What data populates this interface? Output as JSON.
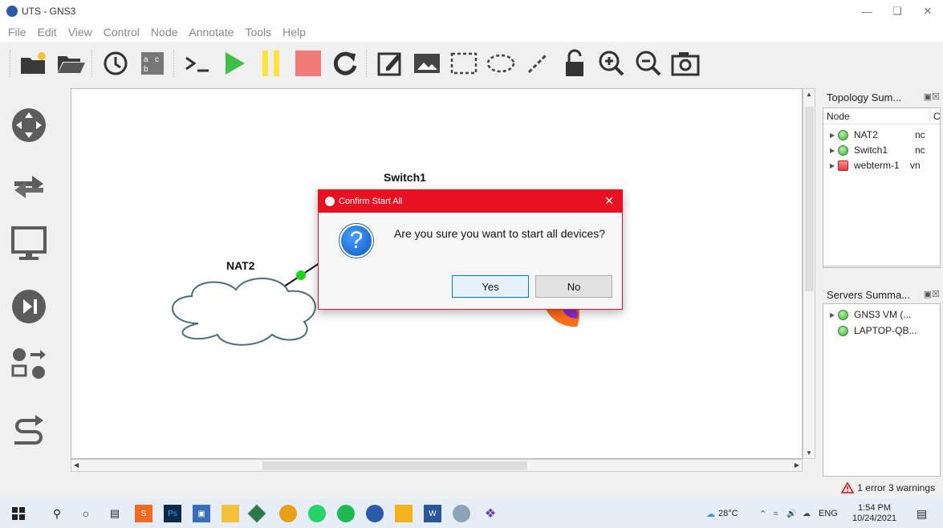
{
  "window": {
    "title": "UTS - GNS3"
  },
  "menu": [
    "File",
    "Edit",
    "View",
    "Control",
    "Node",
    "Annotate",
    "Tools",
    "Help"
  ],
  "toolbar": {
    "icons": [
      "open-project-icon",
      "open-folder-icon",
      "snapshot-clock-icon",
      "show-interface-labels-icon",
      "console-all-icon",
      "start-all-icon",
      "suspend-all-icon",
      "stop-all-icon",
      "reload-all-icon",
      "add-note-icon",
      "insert-picture-icon",
      "draw-rectangle-icon",
      "draw-ellipse-icon",
      "draw-line-icon",
      "lock-unlock-icon",
      "zoom-in-icon",
      "zoom-out-icon",
      "screenshot-icon"
    ]
  },
  "canvas": {
    "nodes": [
      {
        "label": "Switch1"
      },
      {
        "label": "NAT2"
      }
    ]
  },
  "topology_summary": {
    "title": "Topology Sum...",
    "columns": [
      "Node",
      "Co"
    ],
    "rows": [
      {
        "name": "NAT2",
        "console": "nc",
        "status": "green"
      },
      {
        "name": "Switch1",
        "console": "nc",
        "status": "green"
      },
      {
        "name": "webterm-1",
        "console": "vn",
        "status": "red"
      }
    ]
  },
  "servers_summary": {
    "title": "Servers Summa...",
    "rows": [
      {
        "name": "GNS3 VM (...",
        "status": "green"
      },
      {
        "name": "LAPTOP-QB...",
        "status": "green"
      }
    ]
  },
  "status": {
    "message": "1 error 3 warnings"
  },
  "dialog": {
    "title": "Confirm Start All",
    "message": "Are you sure you want to start all devices?",
    "yes_label": "Yes",
    "no_label": "No"
  },
  "taskbar": {
    "weather": "28°C",
    "language": "ENG",
    "time": "1:54 PM",
    "date": "10/24/2021"
  }
}
